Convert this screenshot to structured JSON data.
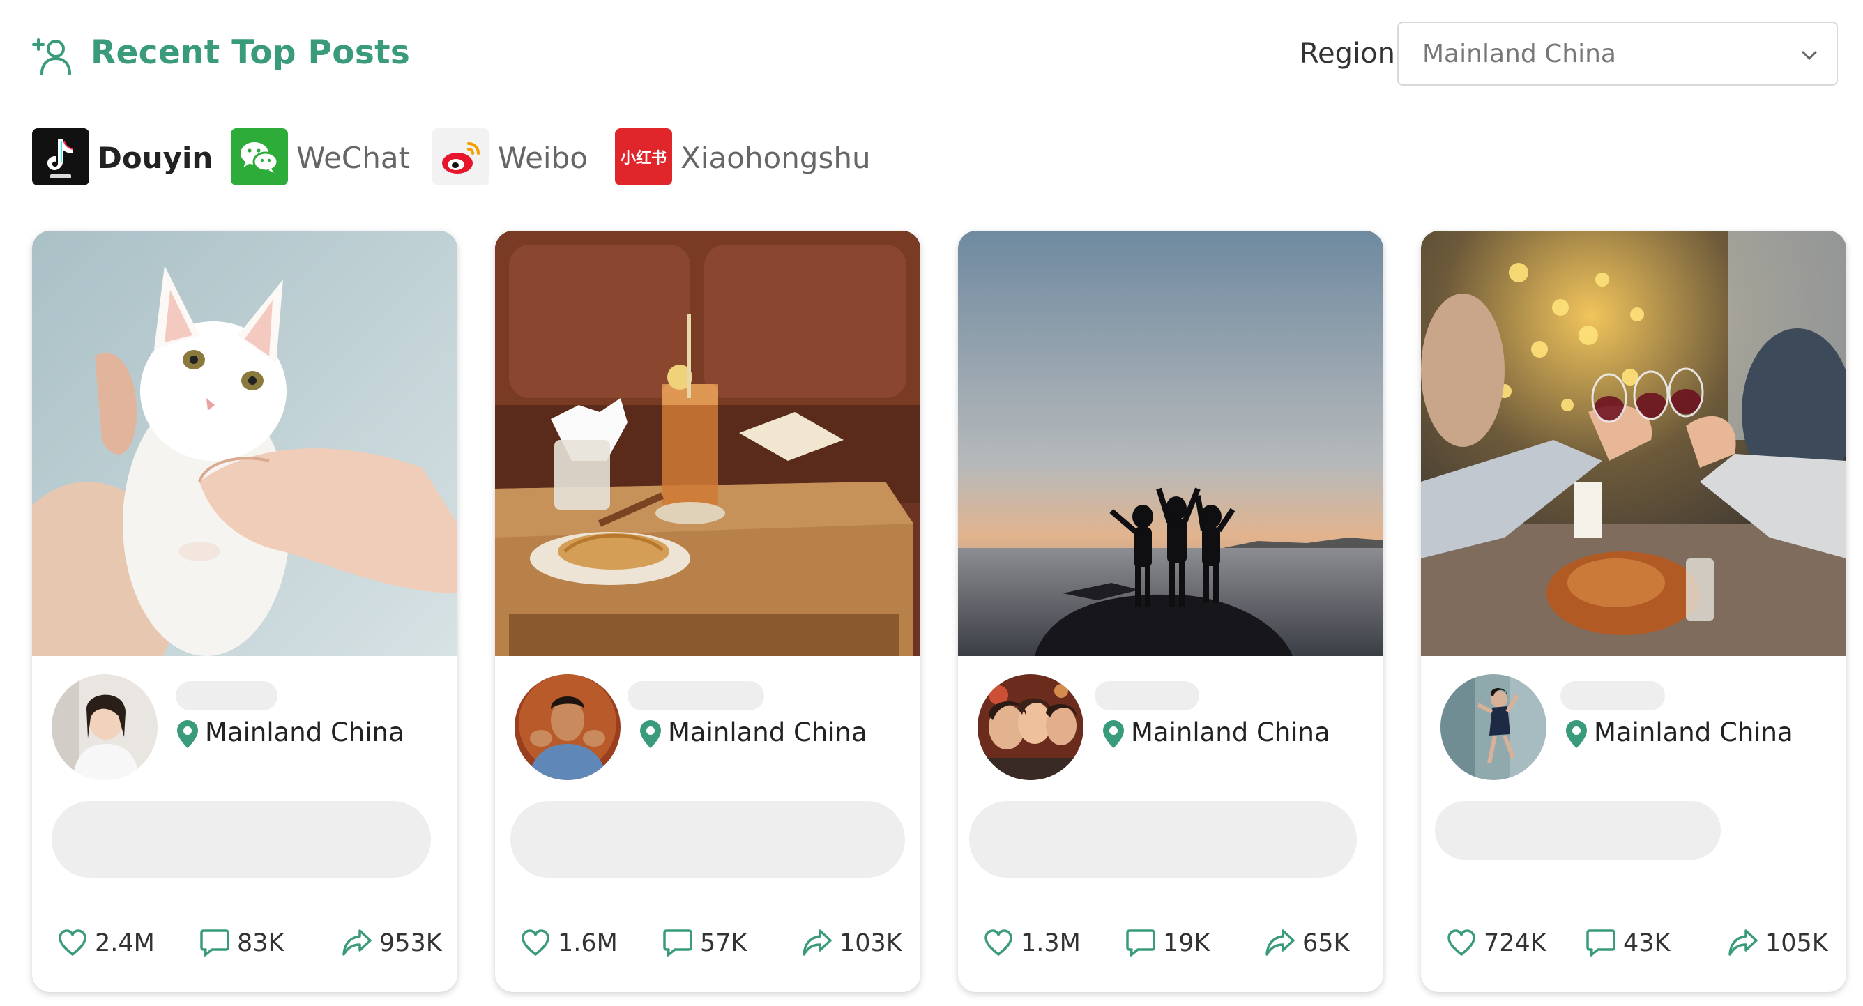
{
  "header": {
    "title": "Recent Top Posts",
    "title_icon": "add-user-icon",
    "accent_color": "#3a9b7c",
    "region_label": "Region",
    "region_value": "Mainland China"
  },
  "platforms": [
    {
      "label": "Douyin",
      "active": true,
      "icon": "douyin-logo"
    },
    {
      "label": "WeChat",
      "active": false,
      "icon": "wechat-logo"
    },
    {
      "label": "Weibo",
      "active": false,
      "icon": "weibo-logo"
    },
    {
      "label": "Xiaohongshu",
      "active": false,
      "icon": "xiaohongshu-logo",
      "logo_text": "小红书"
    }
  ],
  "posts": [
    {
      "image": "kitten-photo",
      "location": "Mainland China",
      "likes": "2.4M",
      "comments": "83K",
      "shares": "953K"
    },
    {
      "image": "cafe-drink-photo",
      "location": "Mainland China",
      "likes": "1.6M",
      "comments": "57K",
      "shares": "103K"
    },
    {
      "image": "sunset-friends-photo",
      "location": "Mainland China",
      "likes": "1.3M",
      "comments": "19K",
      "shares": "65K"
    },
    {
      "image": "holiday-toast-photo",
      "location": "Mainland China",
      "likes": "724K",
      "comments": "43K",
      "shares": "105K"
    }
  ]
}
